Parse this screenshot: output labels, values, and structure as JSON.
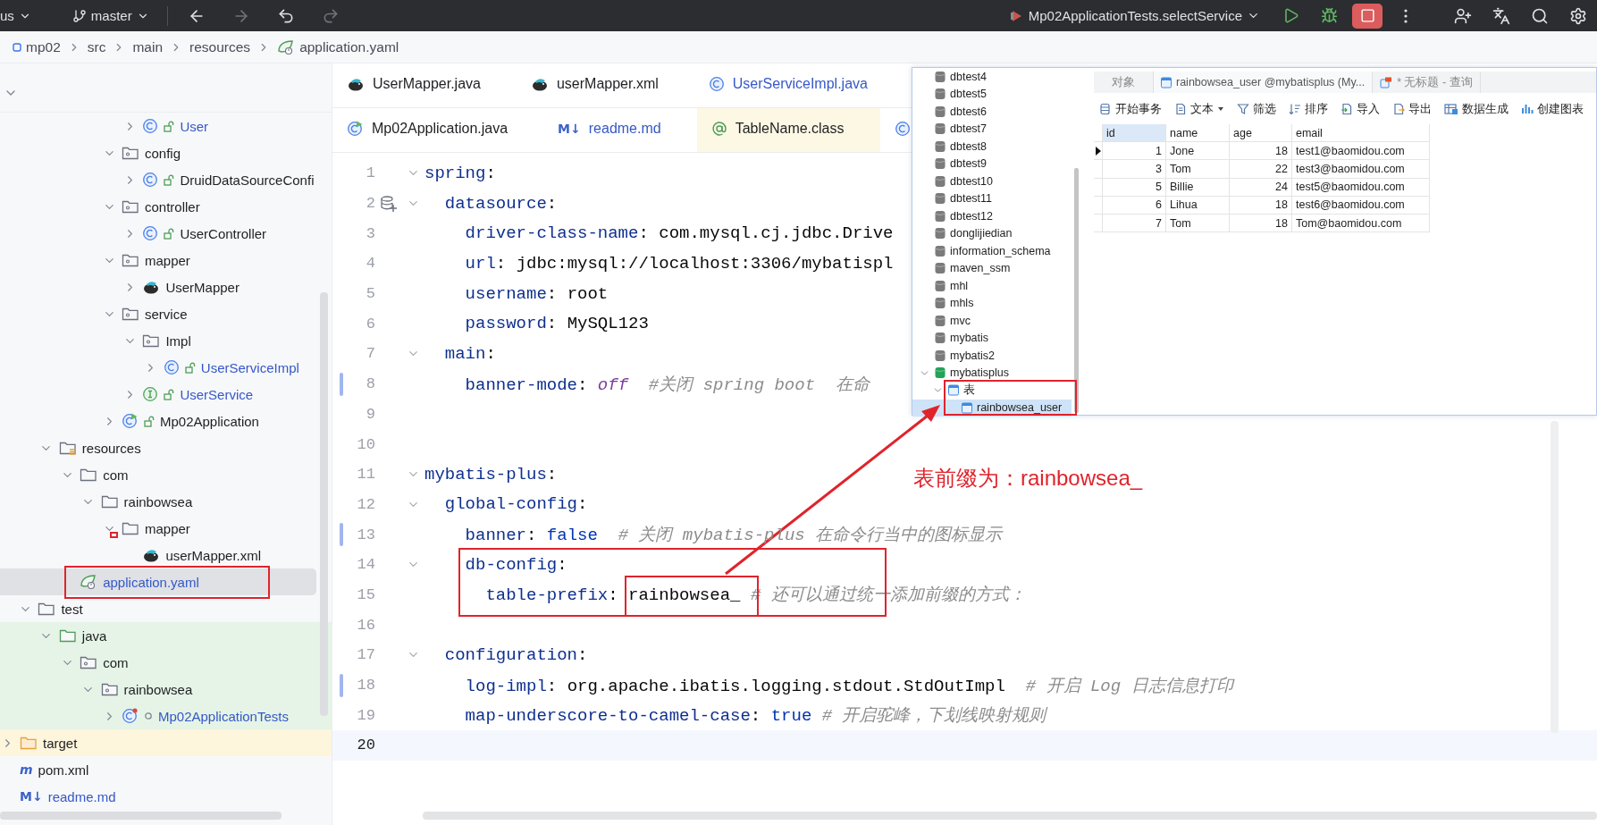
{
  "top_bar": {
    "project": "us",
    "branch": "master",
    "nav": [
      {
        "kind": "back",
        "disabled": false
      },
      {
        "kind": "forward",
        "disabled": true
      },
      {
        "kind": "undo",
        "disabled": false
      },
      {
        "kind": "redo",
        "disabled": true
      }
    ],
    "run_config": "Mp02ApplicationTests.selectService",
    "running": true
  },
  "breadcrumbs": [
    {
      "label": "mp02",
      "kind": "module"
    },
    {
      "label": "src",
      "kind": "plain"
    },
    {
      "label": "main",
      "kind": "plain"
    },
    {
      "label": "resources",
      "kind": "plain"
    },
    {
      "label": "application.yaml",
      "kind": "spring"
    }
  ],
  "project_tree": {
    "items": [
      {
        "children": [
          {
            "children": [
              {
                "children": [
                  {
                    "children": [
                      {
                        "children": [
                          {
                            "children": [
                              {
                                "label": "User",
                                "kind": "class",
                                "expanded": false,
                                "selected": false,
                                "modified": true
                              }
                            ]
                          },
                          {
                            "label": "config",
                            "kind": "package",
                            "expanded": true,
                            "selected": false,
                            "modified": false,
                            "children": [
                              {
                                "label": "DruidDataSourceConfi",
                                "kind": "class",
                                "expanded": false,
                                "selected": false,
                                "modified": false
                              }
                            ]
                          },
                          {
                            "label": "controller",
                            "kind": "package",
                            "expanded": true,
                            "selected": false,
                            "modified": false,
                            "children": [
                              {
                                "label": "UserController",
                                "kind": "class",
                                "expanded": false,
                                "selected": false,
                                "modified": false
                              }
                            ]
                          },
                          {
                            "label": "mapper",
                            "kind": "package",
                            "expanded": true,
                            "selected": false,
                            "modified": false,
                            "children": [
                              {
                                "label": "UserMapper",
                                "kind": "mapper",
                                "expanded": false,
                                "selected": false,
                                "modified": false
                              }
                            ]
                          },
                          {
                            "label": "service",
                            "kind": "package",
                            "expanded": true,
                            "selected": false,
                            "modified": false,
                            "children": [
                              {
                                "label": "Impl",
                                "kind": "package",
                                "expanded": true,
                                "selected": false,
                                "modified": false,
                                "children": [
                                  {
                                    "label": "UserServiceImpl",
                                    "kind": "class",
                                    "expanded": false,
                                    "selected": false,
                                    "modified": true
                                  }
                                ]
                              },
                              {
                                "label": "UserService",
                                "kind": "interface",
                                "expanded": false,
                                "selected": false,
                                "modified": true
                              }
                            ]
                          },
                          {
                            "label": "Mp02Application",
                            "kind": "app",
                            "expanded": false,
                            "selected": false,
                            "modified": false
                          }
                        ]
                      }
                    ]
                  }
                ]
              },
              {
                "label": "resources",
                "kind": "resources",
                "expanded": true,
                "selected": false,
                "modified": false,
                "children": [
                  {
                    "label": "com",
                    "kind": "folder",
                    "expanded": true,
                    "selected": false,
                    "modified": false,
                    "children": [
                      {
                        "label": "rainbowsea",
                        "kind": "folder",
                        "expanded": true,
                        "selected": false,
                        "modified": false,
                        "children": [
                          {
                            "label": "mapper",
                            "kind": "folder",
                            "expanded": true,
                            "selected": false,
                            "modified": false,
                            "children": [
                              {
                                "label": "userMapper.xml",
                                "kind": "mapper",
                                "selected": false,
                                "modified": false
                              }
                            ]
                          }
                        ]
                      }
                    ]
                  },
                  {
                    "label": "application.yaml",
                    "kind": "spring",
                    "selected": true,
                    "modified": true
                  }
                ]
              }
            ]
          },
          {
            "label": "test",
            "kind": "folder",
            "expanded": true,
            "selected": false,
            "modified": false,
            "children": [
              {
                "label": "java",
                "kind": "test-source",
                "expanded": true,
                "selected": false,
                "modified": false,
                "test_scope": true,
                "children": [
                  {
                    "label": "com",
                    "kind": "package",
                    "expanded": true,
                    "selected": false,
                    "modified": false,
                    "test_scope": true,
                    "children": [
                      {
                        "label": "rainbowsea",
                        "kind": "package",
                        "expanded": true,
                        "selected": false,
                        "modified": false,
                        "test_scope": true,
                        "children": [
                          {
                            "label": "Mp02ApplicationTests",
                            "kind": "test-class",
                            "expanded": false,
                            "selected": false,
                            "modified": true,
                            "test_scope": true
                          }
                        ]
                      }
                    ]
                  }
                ]
              }
            ]
          }
        ]
      },
      {
        "label": "target",
        "kind": "excluded",
        "expanded": false,
        "selected": false,
        "modified": false
      },
      {
        "label": "pom.xml",
        "kind": "maven",
        "icon_text": "m",
        "selected": false,
        "modified": false
      },
      {
        "label": "readme.md",
        "kind": "markdown",
        "icon_text": "M↓",
        "selected": false,
        "modified": true
      }
    ]
  },
  "tab_rows": [
    {
      "tabs": [
        {
          "label": "UserMapper.java",
          "kind": "mapper",
          "selected": false,
          "modified": false
        },
        {
          "label": "userMapper.xml",
          "kind": "mapper",
          "selected": false,
          "modified": false
        },
        {
          "label": "UserServiceImpl.java",
          "kind": "class",
          "selected": false,
          "modified": true
        }
      ]
    },
    {
      "tabs": [
        {
          "label": "Mp02Application.java",
          "kind": "app",
          "selected": false,
          "modified": false
        },
        {
          "label": "readme.md",
          "kind": "markdown",
          "icon_text": "M↓",
          "selected": false,
          "modified": true
        },
        {
          "label": "TableName.class",
          "kind": "annotation",
          "selected": false,
          "modified": false,
          "library": true
        },
        {
          "kind": "class",
          "selected": false
        }
      ]
    }
  ],
  "code_lines": [
    {
      "number": "1",
      "fold": true,
      "changed": false,
      "current": false,
      "tokens": [
        {
          "kind": "key",
          "text": "spring"
        },
        {
          "kind": "punct",
          "text": ":"
        }
      ]
    },
    {
      "number": "2",
      "fold": true,
      "changed": false,
      "current": false,
      "gutter_icon": true,
      "tokens": [
        {
          "kind": "key",
          "text": "  datasource"
        },
        {
          "kind": "punct",
          "text": ":"
        }
      ]
    },
    {
      "number": "3",
      "fold": false,
      "changed": false,
      "current": false,
      "tokens": [
        {
          "kind": "key",
          "text": "    driver-class-name"
        },
        {
          "kind": "punct",
          "text": ": "
        },
        {
          "kind": "value",
          "text": "com.mysql.cj.jdbc.Drive"
        }
      ]
    },
    {
      "number": "4",
      "fold": false,
      "changed": false,
      "current": false,
      "tokens": [
        {
          "kind": "key",
          "text": "    url"
        },
        {
          "kind": "punct",
          "text": ": "
        },
        {
          "kind": "value",
          "text": "jdbc:mysql://localhost:3306/mybatispl"
        }
      ]
    },
    {
      "number": "5",
      "fold": false,
      "changed": false,
      "current": false,
      "tokens": [
        {
          "kind": "key",
          "text": "    username"
        },
        {
          "kind": "punct",
          "text": ": "
        },
        {
          "kind": "value",
          "text": "root"
        }
      ]
    },
    {
      "number": "6",
      "fold": false,
      "changed": false,
      "current": false,
      "tokens": [
        {
          "kind": "key",
          "text": "    password"
        },
        {
          "kind": "punct",
          "text": ": "
        },
        {
          "kind": "value",
          "text": "MySQL123"
        }
      ]
    },
    {
      "number": "7",
      "fold": true,
      "changed": false,
      "current": false,
      "tokens": [
        {
          "kind": "key",
          "text": "  main"
        },
        {
          "kind": "punct",
          "text": ":"
        }
      ]
    },
    {
      "number": "8",
      "fold": false,
      "changed": true,
      "current": false,
      "tokens": [
        {
          "kind": "key",
          "text": "    banner-mode"
        },
        {
          "kind": "punct",
          "text": ": "
        },
        {
          "kind": "constant",
          "text": "off  "
        },
        {
          "kind": "comment",
          "text": "#关闭 spring boot  在命"
        }
      ]
    },
    {
      "number": "9",
      "fold": false,
      "changed": false,
      "current": false
    },
    {
      "number": "10",
      "fold": false,
      "changed": false,
      "current": false
    },
    {
      "number": "11",
      "fold": true,
      "changed": false,
      "current": false,
      "tokens": [
        {
          "kind": "key",
          "text": "mybatis-plus"
        },
        {
          "kind": "punct",
          "text": ":"
        }
      ]
    },
    {
      "number": "12",
      "fold": true,
      "changed": false,
      "current": false,
      "tokens": [
        {
          "kind": "key",
          "text": "  global-config"
        },
        {
          "kind": "punct",
          "text": ":"
        }
      ]
    },
    {
      "number": "13",
      "fold": false,
      "changed": true,
      "current": false,
      "tokens": [
        {
          "kind": "key",
          "text": "    banner"
        },
        {
          "kind": "punct",
          "text": ": "
        },
        {
          "kind": "keyword",
          "text": "false  "
        },
        {
          "kind": "comment",
          "text": "# 关闭 mybatis-plus 在命令行当中的图标显示"
        }
      ]
    },
    {
      "number": "14",
      "fold": true,
      "changed": false,
      "current": false,
      "tokens": [
        {
          "kind": "key",
          "text": "    db-config"
        },
        {
          "kind": "punct",
          "text": ":"
        }
      ]
    },
    {
      "number": "15",
      "fold": false,
      "changed": false,
      "current": false,
      "tokens": [
        {
          "kind": "key",
          "text": "      table-prefix"
        },
        {
          "kind": "punct",
          "text": ": "
        },
        {
          "kind": "value",
          "text": "rainbowsea_ "
        },
        {
          "kind": "comment",
          "text": "# 还可以通过统一添加前缀的方式："
        }
      ]
    },
    {
      "number": "16",
      "fold": false,
      "changed": false,
      "current": false
    },
    {
      "number": "17",
      "fold": true,
      "changed": false,
      "current": false,
      "tokens": [
        {
          "kind": "key",
          "text": "  configuration"
        },
        {
          "kind": "punct",
          "text": ":"
        }
      ]
    },
    {
      "number": "18",
      "fold": false,
      "changed": true,
      "current": false,
      "tokens": [
        {
          "kind": "key",
          "text": "    log-impl"
        },
        {
          "kind": "punct",
          "text": ": "
        },
        {
          "kind": "value",
          "text": "org.apache.ibatis.logging.stdout.StdOutImpl  "
        },
        {
          "kind": "comment",
          "text": "# 开启 Log 日志信息打印"
        }
      ]
    },
    {
      "number": "19",
      "fold": false,
      "changed": false,
      "current": false,
      "tokens": [
        {
          "kind": "key",
          "text": "    map-underscore-to-camel-case"
        },
        {
          "kind": "punct",
          "text": ": "
        },
        {
          "kind": "keyword",
          "text": "true "
        },
        {
          "kind": "comment",
          "text": "# 开启驼峰，下划线映射规则"
        }
      ]
    },
    {
      "number": "20",
      "fold": false,
      "changed": false,
      "current": true
    }
  ],
  "db_window": {
    "databases": [
      {
        "label": "dbtest4",
        "selected": false
      },
      {
        "label": "dbtest5",
        "selected": false
      },
      {
        "label": "dbtest6",
        "selected": false
      },
      {
        "label": "dbtest7",
        "selected": false
      },
      {
        "label": "dbtest8",
        "selected": false
      },
      {
        "label": "dbtest9",
        "selected": false
      },
      {
        "label": "dbtest10",
        "selected": false
      },
      {
        "label": "dbtest11",
        "selected": false
      },
      {
        "label": "dbtest12",
        "selected": false
      },
      {
        "label": "donglijiedian",
        "selected": false
      },
      {
        "label": "information_schema",
        "selected": false
      },
      {
        "label": "maven_ssm",
        "selected": false
      },
      {
        "label": "mhl",
        "selected": false
      },
      {
        "label": "mhls",
        "selected": false
      },
      {
        "label": "mvc",
        "selected": false
      },
      {
        "label": "mybatis",
        "selected": false
      },
      {
        "label": "mybatis2",
        "selected": false
      },
      {
        "label": "mybatisplus",
        "selected": false,
        "expanded": true,
        "children": [
          {
            "label": "表",
            "kind": "tables",
            "selected": false,
            "expanded": true,
            "children": [
              {
                "label": "rainbowsea_user",
                "kind": "table",
                "selected": true
              }
            ]
          }
        ]
      }
    ],
    "tabs": [
      {
        "label": "对象",
        "kind": "objects",
        "selected": false
      },
      {
        "label": "rainbowsea_user @mybatisplus (My...",
        "kind": "table",
        "selected": true
      },
      {
        "label": "* 无标题 - 查询",
        "kind": "query",
        "selected": false
      }
    ],
    "toolbar": [
      {
        "label": "开始事务",
        "kind": "transaction",
        "dropdown": false
      },
      {
        "label": "文本",
        "kind": "text",
        "dropdown": true
      },
      {
        "label": "筛选",
        "kind": "filter",
        "dropdown": false
      },
      {
        "label": "排序",
        "kind": "sort",
        "dropdown": false
      },
      {
        "label": "导入",
        "kind": "import",
        "dropdown": false
      },
      {
        "label": "导出",
        "kind": "export",
        "dropdown": false
      },
      {
        "label": "数据生成",
        "kind": "generate",
        "dropdown": false
      },
      {
        "label": "创建图表",
        "kind": "chart",
        "dropdown": false
      }
    ],
    "table": {
      "columns": [
        {
          "label": "id",
          "selected": true,
          "numeric": true
        },
        {
          "label": "name",
          "selected": false,
          "numeric": false
        },
        {
          "label": "age",
          "selected": false,
          "numeric": true
        },
        {
          "label": "email",
          "selected": false,
          "numeric": false
        }
      ],
      "rows": [
        {
          "current": true,
          "cells": [
            "1",
            "Jone",
            "18",
            "test1@baomidou.com"
          ]
        },
        {
          "current": false,
          "cells": [
            "3",
            "Tom",
            "22",
            "test3@baomidou.com"
          ]
        },
        {
          "current": false,
          "cells": [
            "5",
            "Billie",
            "24",
            "test5@baomidou.com"
          ]
        },
        {
          "current": false,
          "cells": [
            "6",
            "Lihua",
            "18",
            "test6@baomidou.com"
          ]
        },
        {
          "current": false,
          "cells": [
            "7",
            "Tom",
            "18",
            "Tom@baomidou.com"
          ]
        }
      ]
    }
  },
  "annotation": {
    "label": "表前缀为：rainbowsea_"
  }
}
